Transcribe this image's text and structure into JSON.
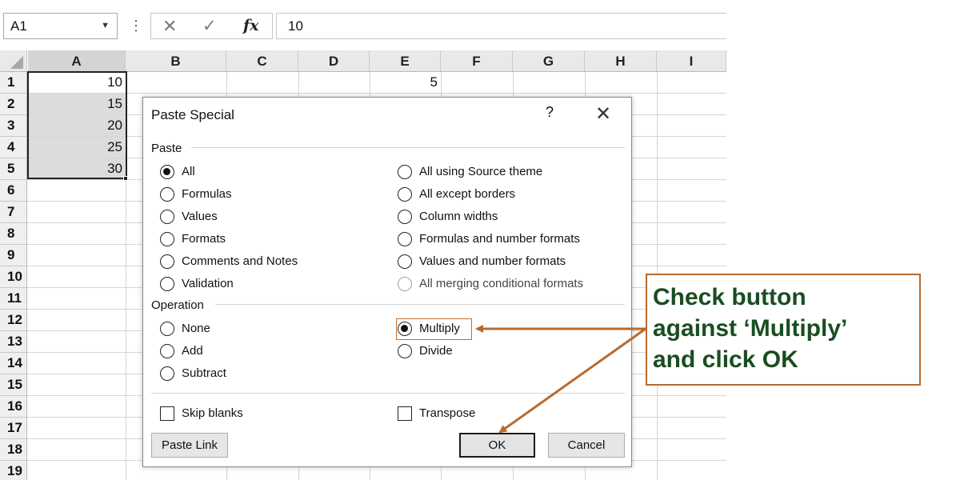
{
  "formula_bar": {
    "name_box": "A1",
    "cancel_icon": "cancel-icon",
    "enter_icon": "enter-check-icon",
    "function_label": "fx",
    "formula_value": "10"
  },
  "sheet": {
    "columns": [
      "A",
      "B",
      "C",
      "D",
      "E",
      "F",
      "G",
      "H",
      "I"
    ],
    "rows": [
      "1",
      "2",
      "3",
      "4",
      "5",
      "6",
      "7",
      "8",
      "9",
      "10",
      "11",
      "12",
      "13",
      "14",
      "15",
      "16",
      "17",
      "18",
      "19"
    ],
    "column_a_values": [
      "10",
      "15",
      "20",
      "25",
      "30"
    ],
    "e1_value": "5"
  },
  "dialog": {
    "title": "Paste Special",
    "help": "?",
    "close": "✕",
    "paste_label": "Paste",
    "paste_left": [
      {
        "label": "All",
        "selected": true
      },
      {
        "label": "Formulas"
      },
      {
        "label": "Values"
      },
      {
        "label": "Formats"
      },
      {
        "label": "Comments and Notes"
      },
      {
        "label": "Validation"
      }
    ],
    "paste_right": [
      {
        "label": "All using Source theme"
      },
      {
        "label": "All except borders"
      },
      {
        "label": "Column widths"
      },
      {
        "label": "Formulas and number formats"
      },
      {
        "label": "Values and number formats"
      },
      {
        "label": "All merging conditional formats",
        "disabled": true
      }
    ],
    "operation_label": "Operation",
    "operation_left": [
      {
        "label": "None"
      },
      {
        "label": "Add"
      },
      {
        "label": "Subtract"
      }
    ],
    "operation_right": [
      {
        "label": "Multiply",
        "selected": true
      },
      {
        "label": "Divide"
      }
    ],
    "skip_blanks": "Skip blanks",
    "transpose": "Transpose",
    "paste_link": "Paste Link",
    "ok": "OK",
    "cancel": "Cancel"
  },
  "callout": {
    "line1": "Check button",
    "line2": "against ‘Multiply’",
    "line3": "and click OK",
    "color": "#1a4d22",
    "border_color": "#b76a2e"
  }
}
